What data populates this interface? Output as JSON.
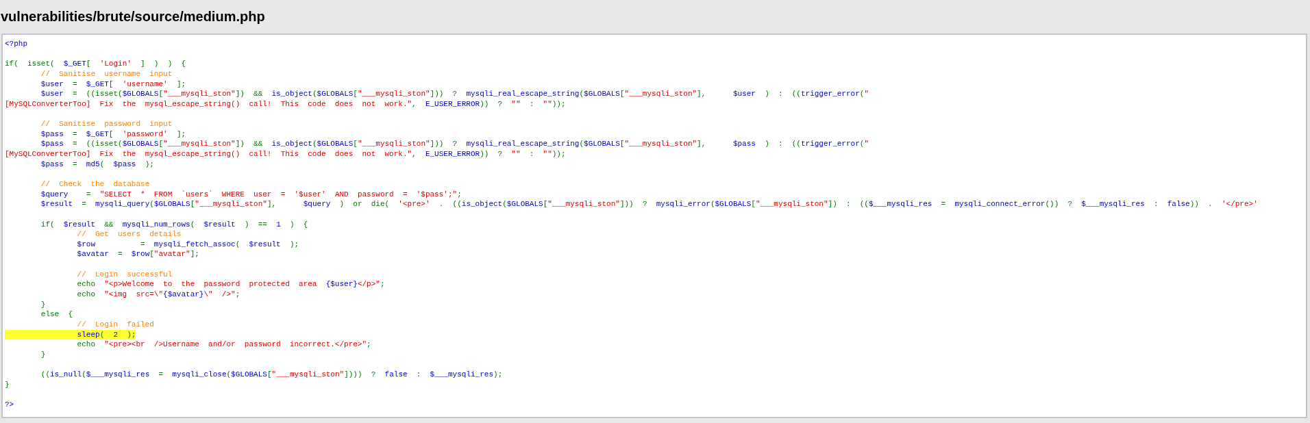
{
  "title": "vulnerabilities/brute/source/medium.php",
  "lines": [
    {
      "kind": "code",
      "highlighted": false,
      "tokens": [
        {
          "kind": "default",
          "text": "<?php"
        }
      ]
    },
    {
      "kind": "blank"
    },
    {
      "kind": "code",
      "highlighted": false,
      "tokens": [
        {
          "kind": "keyword",
          "text": "if( isset( "
        },
        {
          "kind": "default",
          "text": "$_GET"
        },
        {
          "kind": "keyword",
          "text": "[ "
        },
        {
          "kind": "string",
          "text": "'Login'"
        },
        {
          "kind": "keyword",
          "text": " ] ) ) {"
        }
      ]
    },
    {
      "kind": "code",
      "highlighted": false,
      "tokens": [
        {
          "kind": "comment",
          "text": "\t// Sanitise username input"
        }
      ]
    },
    {
      "kind": "code",
      "highlighted": false,
      "tokens": [
        {
          "kind": "default",
          "text": "\t$user "
        },
        {
          "kind": "keyword",
          "text": "= "
        },
        {
          "kind": "default",
          "text": "$_GET"
        },
        {
          "kind": "keyword",
          "text": "[ "
        },
        {
          "kind": "string",
          "text": "'username'"
        },
        {
          "kind": "keyword",
          "text": " ];"
        }
      ]
    },
    {
      "kind": "code",
      "highlighted": false,
      "tokens": [
        {
          "kind": "default",
          "text": "\t$user "
        },
        {
          "kind": "keyword",
          "text": "= ((isset("
        },
        {
          "kind": "default",
          "text": "$GLOBALS"
        },
        {
          "kind": "keyword",
          "text": "["
        },
        {
          "kind": "string",
          "text": "\"___mysqli_ston\""
        },
        {
          "kind": "keyword",
          "text": "]) && "
        },
        {
          "kind": "default",
          "text": "is_object"
        },
        {
          "kind": "keyword",
          "text": "("
        },
        {
          "kind": "default",
          "text": "$GLOBALS"
        },
        {
          "kind": "keyword",
          "text": "["
        },
        {
          "kind": "string",
          "text": "\"___mysqli_ston\""
        },
        {
          "kind": "keyword",
          "text": "])) ? "
        },
        {
          "kind": "default",
          "text": "mysqli_real_escape_string"
        },
        {
          "kind": "keyword",
          "text": "("
        },
        {
          "kind": "default",
          "text": "$GLOBALS"
        },
        {
          "kind": "keyword",
          "text": "["
        },
        {
          "kind": "string",
          "text": "\"___mysqli_ston\""
        },
        {
          "kind": "keyword",
          "text": "],   "
        },
        {
          "kind": "default",
          "text": "$user "
        },
        {
          "kind": "keyword",
          "text": ") : (("
        },
        {
          "kind": "default",
          "text": "trigger_error"
        },
        {
          "kind": "keyword",
          "text": "("
        },
        {
          "kind": "string",
          "text": "\""
        }
      ]
    },
    {
      "kind": "code",
      "highlighted": false,
      "tokens": [
        {
          "kind": "string",
          "text": "[MySQLConverterToo] Fix the mysql_escape_string() call! This code does not work.\""
        },
        {
          "kind": "keyword",
          "text": ", "
        },
        {
          "kind": "default",
          "text": "E_USER_ERROR"
        },
        {
          "kind": "keyword",
          "text": ")) ? "
        },
        {
          "kind": "string",
          "text": "\"\""
        },
        {
          "kind": "keyword",
          "text": " : "
        },
        {
          "kind": "string",
          "text": "\"\""
        },
        {
          "kind": "keyword",
          "text": "));"
        }
      ]
    },
    {
      "kind": "blank"
    },
    {
      "kind": "code",
      "highlighted": false,
      "tokens": [
        {
          "kind": "comment",
          "text": "\t// Sanitise password input"
        }
      ]
    },
    {
      "kind": "code",
      "highlighted": false,
      "tokens": [
        {
          "kind": "default",
          "text": "\t$pass "
        },
        {
          "kind": "keyword",
          "text": "= "
        },
        {
          "kind": "default",
          "text": "$_GET"
        },
        {
          "kind": "keyword",
          "text": "[ "
        },
        {
          "kind": "string",
          "text": "'password'"
        },
        {
          "kind": "keyword",
          "text": " ];"
        }
      ]
    },
    {
      "kind": "code",
      "highlighted": false,
      "tokens": [
        {
          "kind": "default",
          "text": "\t$pass "
        },
        {
          "kind": "keyword",
          "text": "= ((isset("
        },
        {
          "kind": "default",
          "text": "$GLOBALS"
        },
        {
          "kind": "keyword",
          "text": "["
        },
        {
          "kind": "string",
          "text": "\"___mysqli_ston\""
        },
        {
          "kind": "keyword",
          "text": "]) && "
        },
        {
          "kind": "default",
          "text": "is_object"
        },
        {
          "kind": "keyword",
          "text": "("
        },
        {
          "kind": "default",
          "text": "$GLOBALS"
        },
        {
          "kind": "keyword",
          "text": "["
        },
        {
          "kind": "string",
          "text": "\"___mysqli_ston\""
        },
        {
          "kind": "keyword",
          "text": "])) ? "
        },
        {
          "kind": "default",
          "text": "mysqli_real_escape_string"
        },
        {
          "kind": "keyword",
          "text": "("
        },
        {
          "kind": "default",
          "text": "$GLOBALS"
        },
        {
          "kind": "keyword",
          "text": "["
        },
        {
          "kind": "string",
          "text": "\"___mysqli_ston\""
        },
        {
          "kind": "keyword",
          "text": "],   "
        },
        {
          "kind": "default",
          "text": "$pass "
        },
        {
          "kind": "keyword",
          "text": ") : (("
        },
        {
          "kind": "default",
          "text": "trigger_error"
        },
        {
          "kind": "keyword",
          "text": "("
        },
        {
          "kind": "string",
          "text": "\""
        }
      ]
    },
    {
      "kind": "code",
      "highlighted": false,
      "tokens": [
        {
          "kind": "string",
          "text": "[MySQLConverterToo] Fix the mysql_escape_string() call! This code does not work.\""
        },
        {
          "kind": "keyword",
          "text": ", "
        },
        {
          "kind": "default",
          "text": "E_USER_ERROR"
        },
        {
          "kind": "keyword",
          "text": ")) ? "
        },
        {
          "kind": "string",
          "text": "\"\""
        },
        {
          "kind": "keyword",
          "text": " : "
        },
        {
          "kind": "string",
          "text": "\"\""
        },
        {
          "kind": "keyword",
          "text": "));"
        }
      ]
    },
    {
      "kind": "code",
      "highlighted": false,
      "tokens": [
        {
          "kind": "default",
          "text": "\t$pass "
        },
        {
          "kind": "keyword",
          "text": "= "
        },
        {
          "kind": "default",
          "text": "md5"
        },
        {
          "kind": "keyword",
          "text": "( "
        },
        {
          "kind": "default",
          "text": "$pass "
        },
        {
          "kind": "keyword",
          "text": ");"
        }
      ]
    },
    {
      "kind": "blank"
    },
    {
      "kind": "code",
      "highlighted": false,
      "tokens": [
        {
          "kind": "comment",
          "text": "\t// Check the database"
        }
      ]
    },
    {
      "kind": "code",
      "highlighted": false,
      "tokens": [
        {
          "kind": "default",
          "text": "\t$query  "
        },
        {
          "kind": "keyword",
          "text": "= "
        },
        {
          "kind": "string",
          "text": "\"SELECT * FROM `users` WHERE user = '$user' AND password = '$pass';\""
        },
        {
          "kind": "keyword",
          "text": ";"
        }
      ]
    },
    {
      "kind": "code",
      "highlighted": false,
      "tokens": [
        {
          "kind": "default",
          "text": "\t$result "
        },
        {
          "kind": "keyword",
          "text": "= "
        },
        {
          "kind": "default",
          "text": "mysqli_query"
        },
        {
          "kind": "keyword",
          "text": "("
        },
        {
          "kind": "default",
          "text": "$GLOBALS"
        },
        {
          "kind": "keyword",
          "text": "["
        },
        {
          "kind": "string",
          "text": "\"___mysqli_ston\""
        },
        {
          "kind": "keyword",
          "text": "],   "
        },
        {
          "kind": "default",
          "text": "$query "
        },
        {
          "kind": "keyword",
          "text": ") or die( "
        },
        {
          "kind": "string",
          "text": "'<pre>'"
        },
        {
          "kind": "keyword",
          "text": " . (("
        },
        {
          "kind": "default",
          "text": "is_object"
        },
        {
          "kind": "keyword",
          "text": "("
        },
        {
          "kind": "default",
          "text": "$GLOBALS"
        },
        {
          "kind": "keyword",
          "text": "["
        },
        {
          "kind": "string",
          "text": "\"___mysqli_ston\""
        },
        {
          "kind": "keyword",
          "text": "])) ? "
        },
        {
          "kind": "default",
          "text": "mysqli_error"
        },
        {
          "kind": "keyword",
          "text": "("
        },
        {
          "kind": "default",
          "text": "$GLOBALS"
        },
        {
          "kind": "keyword",
          "text": "["
        },
        {
          "kind": "string",
          "text": "\"___mysqli_ston\""
        },
        {
          "kind": "keyword",
          "text": "]) : (("
        },
        {
          "kind": "default",
          "text": "$___mysqli_res "
        },
        {
          "kind": "keyword",
          "text": "= "
        },
        {
          "kind": "default",
          "text": "mysqli_connect_error"
        },
        {
          "kind": "keyword",
          "text": "()) ? "
        },
        {
          "kind": "default",
          "text": "$___mysqli_res "
        },
        {
          "kind": "keyword",
          "text": ": "
        },
        {
          "kind": "default",
          "text": "false"
        },
        {
          "kind": "keyword",
          "text": ")) . "
        },
        {
          "kind": "string",
          "text": "'</pre>'"
        }
      ]
    },
    {
      "kind": "blank"
    },
    {
      "kind": "code",
      "highlighted": false,
      "tokens": [
        {
          "kind": "keyword",
          "text": "\tif( "
        },
        {
          "kind": "default",
          "text": "$result "
        },
        {
          "kind": "keyword",
          "text": "&& "
        },
        {
          "kind": "default",
          "text": "mysqli_num_rows"
        },
        {
          "kind": "keyword",
          "text": "( "
        },
        {
          "kind": "default",
          "text": "$result "
        },
        {
          "kind": "keyword",
          "text": ") == "
        },
        {
          "kind": "default",
          "text": "1 "
        },
        {
          "kind": "keyword",
          "text": ") {"
        }
      ]
    },
    {
      "kind": "code",
      "highlighted": false,
      "tokens": [
        {
          "kind": "comment",
          "text": "\t\t// Get users details"
        }
      ]
    },
    {
      "kind": "code",
      "highlighted": false,
      "tokens": [
        {
          "kind": "default",
          "text": "\t\t$row     "
        },
        {
          "kind": "keyword",
          "text": "= "
        },
        {
          "kind": "default",
          "text": "mysqli_fetch_assoc"
        },
        {
          "kind": "keyword",
          "text": "( "
        },
        {
          "kind": "default",
          "text": "$result "
        },
        {
          "kind": "keyword",
          "text": ");"
        }
      ]
    },
    {
      "kind": "code",
      "highlighted": false,
      "tokens": [
        {
          "kind": "default",
          "text": "\t\t$avatar "
        },
        {
          "kind": "keyword",
          "text": "= "
        },
        {
          "kind": "default",
          "text": "$row"
        },
        {
          "kind": "keyword",
          "text": "["
        },
        {
          "kind": "string",
          "text": "\"avatar\""
        },
        {
          "kind": "keyword",
          "text": "];"
        }
      ]
    },
    {
      "kind": "blank"
    },
    {
      "kind": "code",
      "highlighted": false,
      "tokens": [
        {
          "kind": "comment",
          "text": "\t\t// Login successful"
        }
      ]
    },
    {
      "kind": "code",
      "highlighted": false,
      "tokens": [
        {
          "kind": "keyword",
          "text": "\t\techo "
        },
        {
          "kind": "string",
          "text": "\"<p>Welcome to the password protected area "
        },
        {
          "kind": "default",
          "text": "{$user}"
        },
        {
          "kind": "string",
          "text": "</p>\""
        },
        {
          "kind": "keyword",
          "text": ";"
        }
      ]
    },
    {
      "kind": "code",
      "highlighted": false,
      "tokens": [
        {
          "kind": "keyword",
          "text": "\t\techo "
        },
        {
          "kind": "string",
          "text": "\"<img src=\\\""
        },
        {
          "kind": "default",
          "text": "{$avatar}"
        },
        {
          "kind": "string",
          "text": "\\\" />\""
        },
        {
          "kind": "keyword",
          "text": ";"
        }
      ]
    },
    {
      "kind": "code",
      "highlighted": false,
      "tokens": [
        {
          "kind": "keyword",
          "text": "\t}"
        }
      ]
    },
    {
      "kind": "code",
      "highlighted": false,
      "tokens": [
        {
          "kind": "keyword",
          "text": "\telse {"
        }
      ]
    },
    {
      "kind": "code",
      "highlighted": false,
      "tokens": [
        {
          "kind": "comment",
          "text": "\t\t// Login failed"
        }
      ]
    },
    {
      "kind": "code",
      "highlighted": true,
      "tokens": [
        {
          "kind": "default",
          "text": "\t\tsleep"
        },
        {
          "kind": "keyword",
          "text": "( "
        },
        {
          "kind": "default",
          "text": "2 "
        },
        {
          "kind": "keyword",
          "text": ");"
        }
      ]
    },
    {
      "kind": "code",
      "highlighted": false,
      "tokens": [
        {
          "kind": "keyword",
          "text": "\t\techo "
        },
        {
          "kind": "string",
          "text": "\"<pre><br />Username and/or password incorrect.</pre>\""
        },
        {
          "kind": "keyword",
          "text": ";"
        }
      ]
    },
    {
      "kind": "code",
      "highlighted": false,
      "tokens": [
        {
          "kind": "keyword",
          "text": "\t}"
        }
      ]
    },
    {
      "kind": "blank"
    },
    {
      "kind": "code",
      "highlighted": false,
      "tokens": [
        {
          "kind": "keyword",
          "text": "\t(("
        },
        {
          "kind": "default",
          "text": "is_null"
        },
        {
          "kind": "keyword",
          "text": "("
        },
        {
          "kind": "default",
          "text": "$___mysqli_res "
        },
        {
          "kind": "keyword",
          "text": "= "
        },
        {
          "kind": "default",
          "text": "mysqli_close"
        },
        {
          "kind": "keyword",
          "text": "("
        },
        {
          "kind": "default",
          "text": "$GLOBALS"
        },
        {
          "kind": "keyword",
          "text": "["
        },
        {
          "kind": "string",
          "text": "\"___mysqli_ston\""
        },
        {
          "kind": "keyword",
          "text": "]))) ? "
        },
        {
          "kind": "default",
          "text": "false "
        },
        {
          "kind": "keyword",
          "text": ": "
        },
        {
          "kind": "default",
          "text": "$___mysqli_res"
        },
        {
          "kind": "keyword",
          "text": ");"
        }
      ]
    },
    {
      "kind": "code",
      "highlighted": false,
      "tokens": [
        {
          "kind": "keyword",
          "text": "}"
        }
      ]
    },
    {
      "kind": "blank"
    },
    {
      "kind": "code",
      "highlighted": false,
      "tokens": [
        {
          "kind": "default",
          "text": "?>"
        }
      ]
    }
  ]
}
